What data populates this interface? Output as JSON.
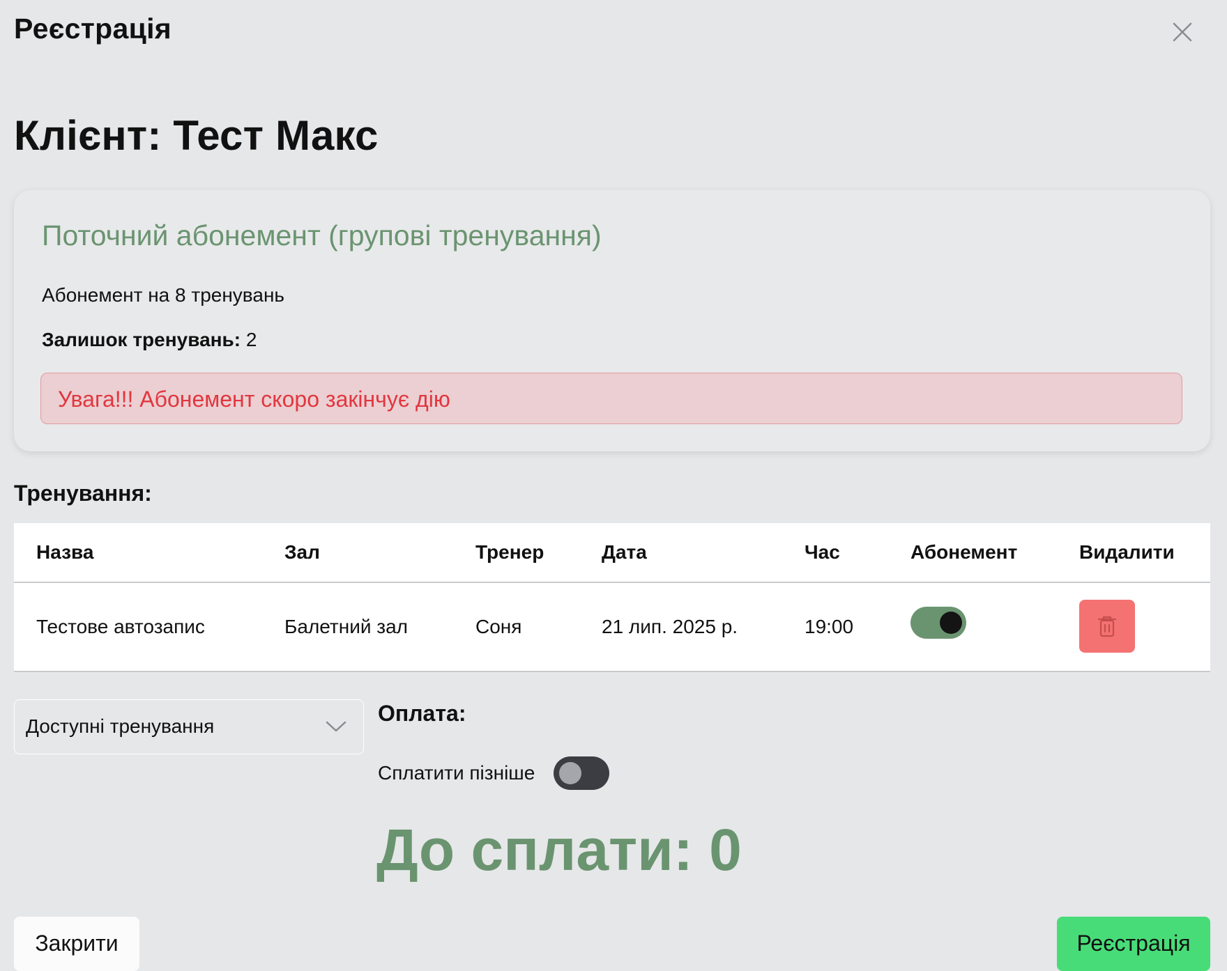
{
  "dialog": {
    "title": "Реєстрація"
  },
  "client_heading": "Клієнт: Тест Макс",
  "subscription": {
    "title": "Поточний абонемент (групові тренування)",
    "plan": "Абонемент на 8 тренувань",
    "remaining_label": "Залишок тренувань:",
    "remaining_value": "2",
    "alert": "Увага!!! Абонемент скоро закінчує дію"
  },
  "trainings": {
    "label": "Тренування:",
    "columns": [
      "Назва",
      "Зал",
      "Тренер",
      "Дата",
      "Час",
      "Абонемент",
      "Видалити"
    ],
    "rows": [
      {
        "name": "Тестове автозапис",
        "hall": "Балетний зал",
        "trainer": "Соня",
        "date": "21 лип. 2025 р.",
        "time": "19:00",
        "subscription_toggle": true
      }
    ]
  },
  "available_select": {
    "placeholder": "Доступні тренування"
  },
  "payment": {
    "label": "Оплата:",
    "pay_later_label": "Сплатити пізніше",
    "pay_later_toggle": false,
    "to_pay": "До сплати: 0"
  },
  "buttons": {
    "close": "Закрити",
    "register": "Реєстрація"
  },
  "colors": {
    "accent_green": "#6a9470",
    "alert_red": "#e2363f",
    "delete_red": "#f57272",
    "register_green": "#48dc78"
  },
  "icons": {
    "close": "close-icon",
    "delete": "trash-icon",
    "dropdown": "chevron-down-icon"
  }
}
